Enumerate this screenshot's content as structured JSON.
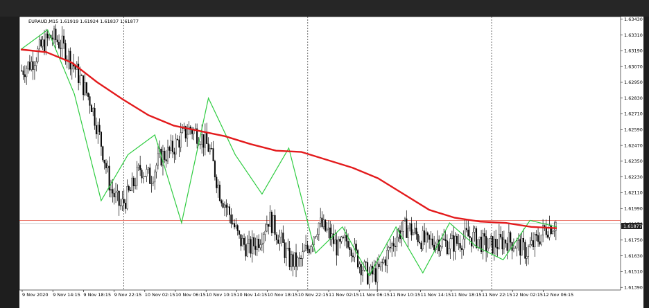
{
  "chart_data": {
    "type": "candlestick",
    "symbol_info": "EURAUD,M15  1.61919 1.61924 1.61837 1.61877",
    "current_price": "1.61877",
    "y_ticks": [
      "1.63430",
      "1.63310",
      "1.63190",
      "1.63070",
      "1.62950",
      "1.62830",
      "1.62710",
      "1.62590",
      "1.62470",
      "1.62350",
      "1.62230",
      "1.62110",
      "1.61990",
      "1.61870",
      "1.61750",
      "1.61630",
      "1.61510",
      "1.61390"
    ],
    "x_ticks": [
      "9 Nov 2020",
      "9 Nov 14:15",
      "9 Nov 18:15",
      "9 Nov 22:15",
      "10 Nov 02:15",
      "10 Nov 06:15",
      "10 Nov 10:15",
      "10 Nov 14:15",
      "10 Nov 18:15",
      "10 Nov 22:15",
      "11 Nov 02:15",
      "11 Nov 06:15",
      "11 Nov 10:15",
      "11 Nov 14:15",
      "11 Nov 18:15",
      "11 Nov 22:15",
      "12 Nov 02:15",
      "12 Nov 06:15"
    ],
    "ylim": [
      1.6137,
      1.6345
    ],
    "period_separators": [
      "9 Nov 22:15",
      "10 Nov 22:15",
      "11 Nov 22:15"
    ],
    "price_series": [
      1.6304,
      1.631,
      1.6322,
      1.633,
      1.6324,
      1.6312,
      1.6296,
      1.628,
      1.625,
      1.6214,
      1.62,
      1.6212,
      1.623,
      1.6222,
      1.6238,
      1.6242,
      1.6252,
      1.626,
      1.6255,
      1.6244,
      1.6212,
      1.6195,
      1.6175,
      1.6168,
      1.6176,
      1.6192,
      1.6178,
      1.616,
      1.6157,
      1.617,
      1.6188,
      1.618,
      1.6168,
      1.6176,
      1.616,
      1.6148,
      1.615,
      1.6165,
      1.618,
      1.6185,
      1.6178,
      1.6172,
      1.6175,
      1.6172,
      1.6173,
      1.6178,
      1.6176,
      1.617,
      1.6172,
      1.6175,
      1.6172,
      1.6166,
      1.6174,
      1.6184,
      1.6188
    ],
    "moving_average": {
      "name": "",
      "color": "#e31a1c",
      "values": [
        1.632,
        1.6318,
        1.631,
        1.6295,
        1.6282,
        1.627,
        1.6262,
        1.6258,
        1.6254,
        1.6248,
        1.6243,
        1.6242,
        1.6236,
        1.623,
        1.6222,
        1.621,
        1.6198,
        1.6192,
        1.6189,
        1.6188,
        1.6185,
        1.6184
      ]
    },
    "zigzag": {
      "name": "",
      "color": "#2ecc40",
      "values": [
        1.632,
        1.6335,
        1.6286,
        1.6205,
        1.624,
        1.6255,
        1.6188,
        1.6283,
        1.624,
        1.621,
        1.6245,
        1.6165,
        1.6185,
        1.6148,
        1.6185,
        1.615,
        1.6188,
        1.617,
        1.616,
        1.619,
        1.6185
      ]
    },
    "horizontal_lines": [
      {
        "value": 1.619,
        "color": "#e74c3c"
      },
      {
        "value": 1.61877,
        "color": "#bbbbbb"
      }
    ],
    "candle_color": "#000000",
    "background": "#ffffff"
  }
}
